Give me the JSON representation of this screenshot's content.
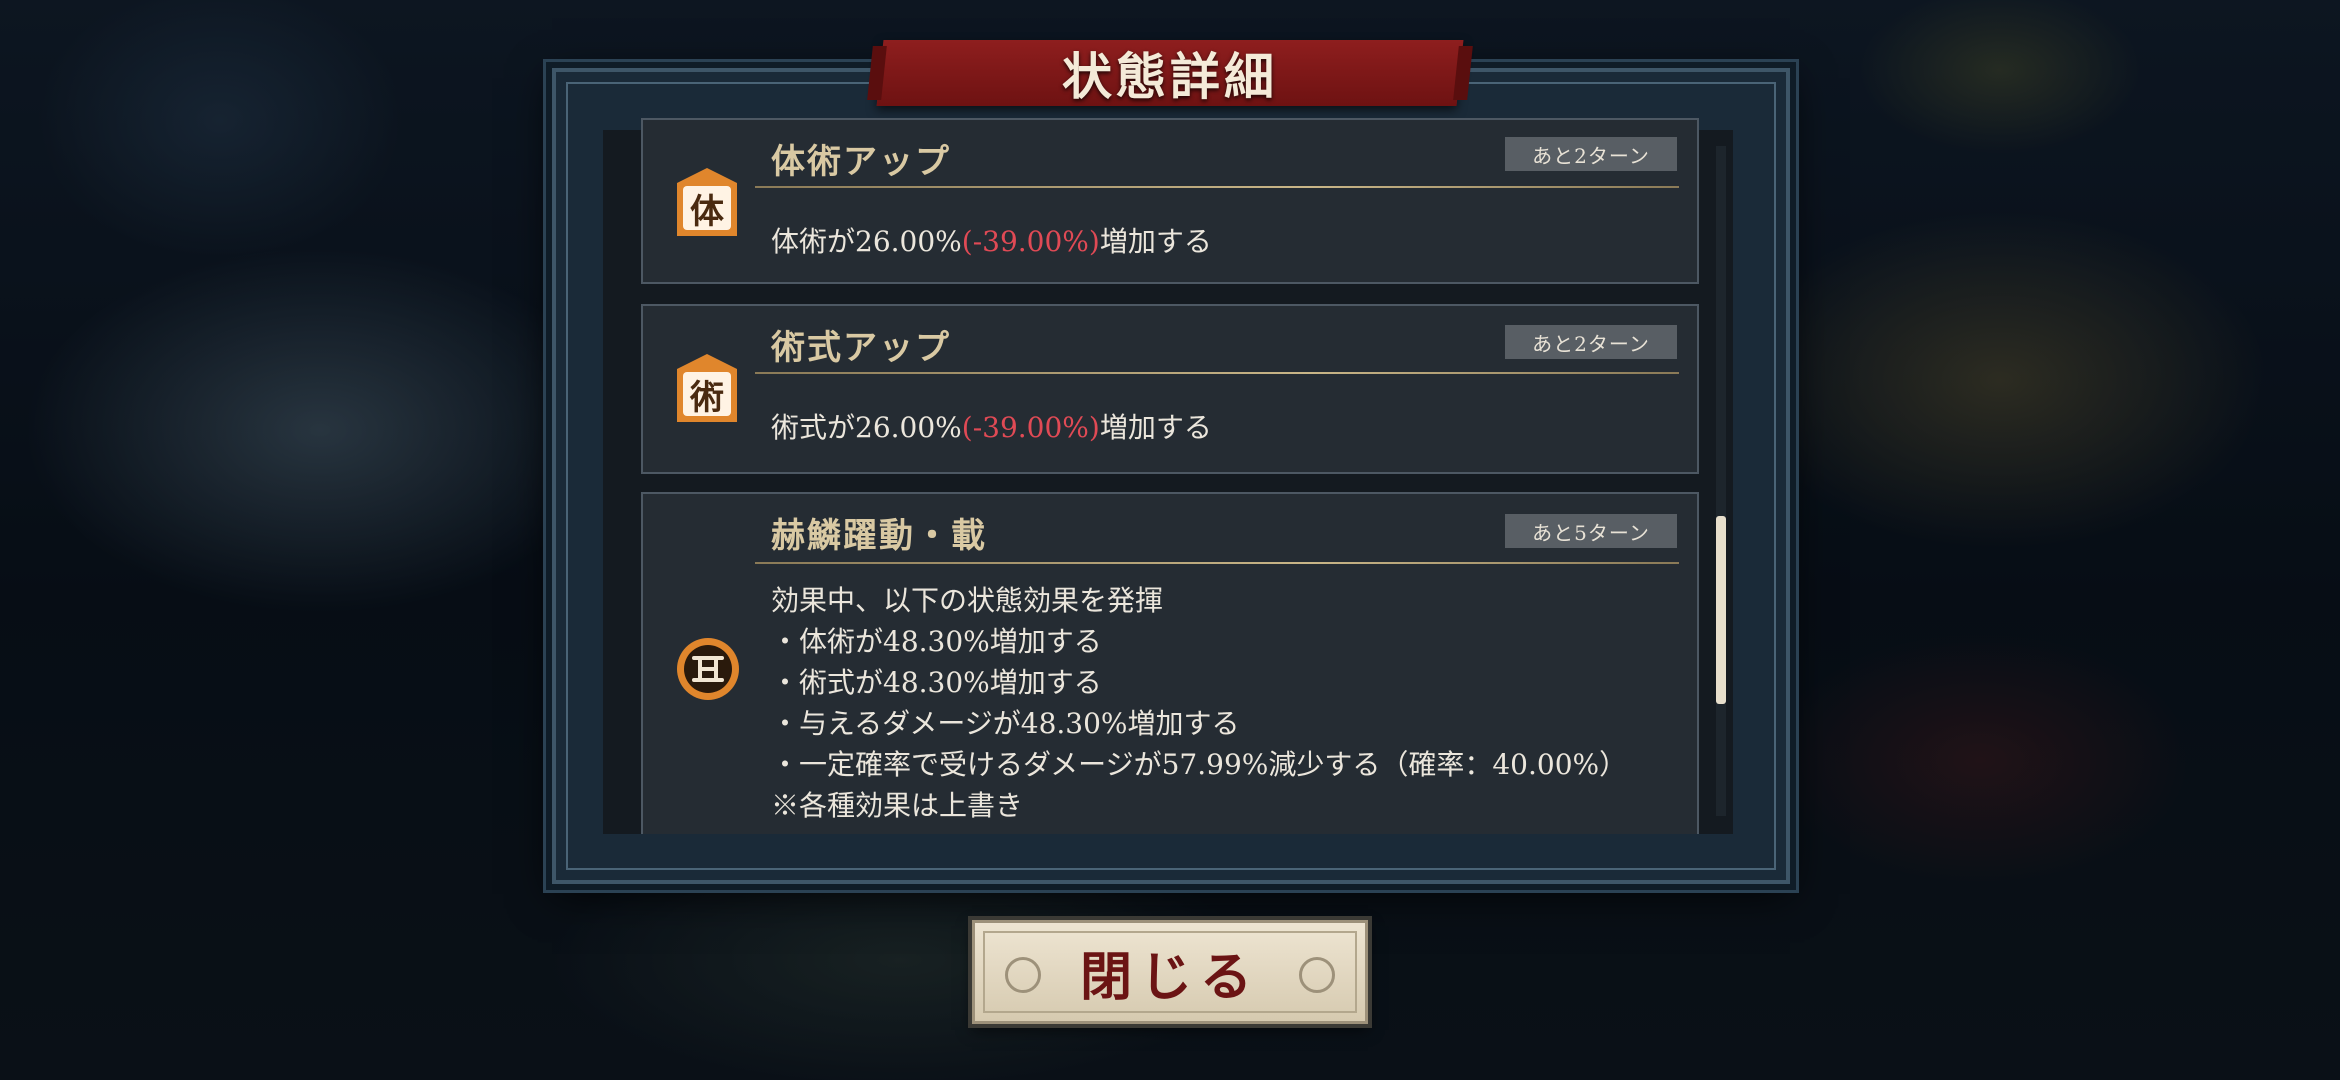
{
  "dialog": {
    "title": "状態詳細",
    "close_label": "閉じる"
  },
  "statuses": [
    {
      "icon": "taijutsu-badge-icon",
      "icon_glyph": "体",
      "name": "体術アップ",
      "turns": "あと2ターン",
      "desc_prefix": "体術が26.00%",
      "desc_negative": "(-39.00%)",
      "desc_suffix": "増加する"
    },
    {
      "icon": "jutsushiki-badge-icon",
      "icon_glyph": "術",
      "name": "術式アップ",
      "turns": "あと2ターン",
      "desc_prefix": "術式が26.00%",
      "desc_negative": "(-39.00%)",
      "desc_suffix": "増加する"
    },
    {
      "icon": "special-emblem-icon",
      "name": "赫鱗躍動・載",
      "turns": "あと5ターン",
      "lines": [
        "効果中、以下の状態効果を発揮",
        "・体術が48.30%増加する",
        "・術式が48.30%増加する",
        "・与えるダメージが48.30%増加する",
        "・一定確率で受けるダメージが57.99%減少する（確率：40.00%）",
        "※各種効果は上書き"
      ]
    }
  ],
  "colors": {
    "title_banner": "#8e1e1e",
    "negative_value": "#e04a55",
    "badge": "#e0862c",
    "status_name": "#d9c9a3"
  }
}
